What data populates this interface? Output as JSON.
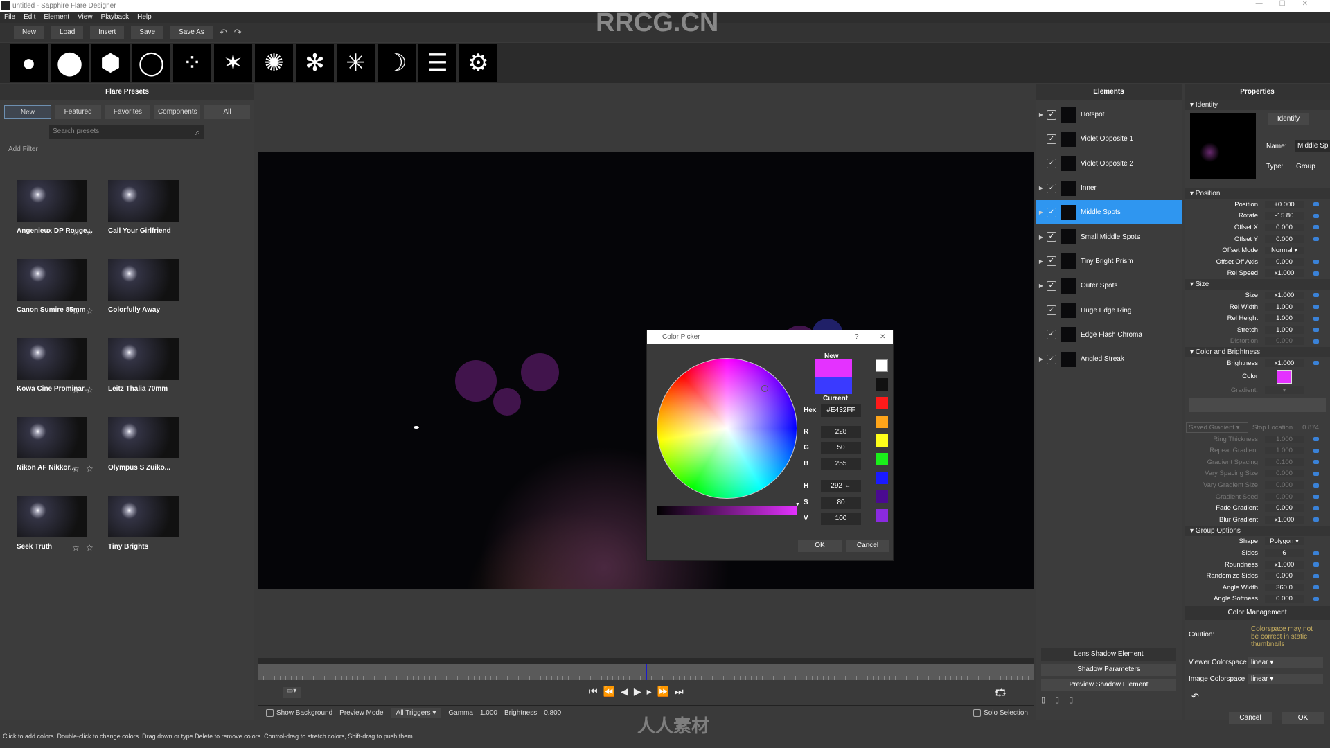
{
  "window": {
    "title": "untitled - Sapphire Flare Designer",
    "watermark": "RRCG.CN",
    "bottom_watermark": "人人素材"
  },
  "menu": [
    "File",
    "Edit",
    "Element",
    "View",
    "Playback",
    "Help"
  ],
  "toolbar": {
    "buttons": [
      "New",
      "Load",
      "Insert",
      "Save",
      "Save As"
    ],
    "icons": [
      "undo-icon",
      "redo-icon"
    ]
  },
  "element_strip": [
    "glow",
    "disc",
    "polygon",
    "ring",
    "spots",
    "star-streak",
    "rays",
    "starburst",
    "sparkle",
    "arc",
    "streaks",
    "settings"
  ],
  "presets_panel": {
    "title": "Flare Presets",
    "tabs": [
      "New",
      "Featured",
      "Favorites",
      "Components",
      "All"
    ],
    "active_tab": "New",
    "search_placeholder": "Search presets",
    "add_filter": "Add Filter",
    "presets": [
      "Angenieux DP Rouge...",
      "Call Your Girlfriend",
      "Canon Sumire 85mm",
      "Colorfully Away",
      "Kowa Cine Prominar...",
      "Leitz Thalia 70mm",
      "Nikon AF Nikkor...",
      "Olympus S Zuiko...",
      "Seek Truth",
      "Tiny Brights"
    ]
  },
  "viewer": {
    "show_background": "Show Background",
    "preview_mode": "Preview Mode",
    "triggers": "All Triggers",
    "gamma_label": "Gamma",
    "gamma": "1.000",
    "brightness_label": "Brightness",
    "brightness": "0.800",
    "solo_selection": "Solo Selection"
  },
  "status": "Click to add colors. Double-click to change colors. Drag down or type Delete to remove colors. Control-drag to stretch colors, Shift-drag to push them.",
  "elements_panel": {
    "title": "Elements",
    "selected": "Middle Spots",
    "items": [
      {
        "name": "Hotspot",
        "expand": true
      },
      {
        "name": "Violet Opposite 1",
        "expand": false
      },
      {
        "name": "Violet Opposite 2",
        "expand": false
      },
      {
        "name": "Inner",
        "expand": true
      },
      {
        "name": "Middle Spots",
        "expand": true
      },
      {
        "name": "Small Middle Spots",
        "expand": true
      },
      {
        "name": "Tiny Bright Prism",
        "expand": true
      },
      {
        "name": "Outer Spots",
        "expand": true
      },
      {
        "name": "Huge Edge Ring",
        "expand": false
      },
      {
        "name": "Edge Flash Chroma",
        "expand": false
      },
      {
        "name": "Angled Streak",
        "expand": true
      }
    ],
    "lens_shadow": "Lens Shadow Element",
    "shadow_params": "Shadow Parameters",
    "preview_shadow": "Preview Shadow Element"
  },
  "properties": {
    "title": "Properties",
    "identity": "Identity",
    "identify": "Identify",
    "name_label": "Name:",
    "name": "Middle Sp",
    "type_label": "Type:",
    "type": "Group",
    "position_section": "Position",
    "position": [
      [
        "Position",
        "+0.000"
      ],
      [
        "Rotate",
        "-15.80"
      ],
      [
        "Offset X",
        "0.000"
      ],
      [
        "Offset Y",
        "0.000"
      ],
      [
        "Offset Mode",
        "Normal"
      ],
      [
        "Offset Off Axis",
        "0.000"
      ],
      [
        "Rel Speed",
        "x1.000"
      ]
    ],
    "size_section": "Size",
    "size": [
      [
        "Size",
        "x1.000"
      ],
      [
        "Rel Width",
        "1.000"
      ],
      [
        "Rel Height",
        "1.000"
      ],
      [
        "Stretch",
        "1.000"
      ],
      [
        "Distortion",
        "0.000"
      ]
    ],
    "color_section": "Color and Brightness",
    "brightness": [
      "Brightness",
      "x1.000"
    ],
    "color_label": "Color",
    "color": "#E432FF",
    "gradient_label": "Gradient:",
    "saved_gradient": "Saved Gradient",
    "stop_location_label": "Stop Location",
    "stop_location": "0.874",
    "gradient": [
      [
        "Ring Thickness",
        "1.000",
        true
      ],
      [
        "Repeat Gradient",
        "1.000",
        true
      ],
      [
        "Gradient Spacing",
        "0.100",
        true
      ],
      [
        "Vary Spacing Size",
        "0.000",
        true
      ],
      [
        "Vary Gradient Size",
        "0.000",
        true
      ],
      [
        "Gradient Seed",
        "0.000",
        true
      ],
      [
        "Fade Gradient",
        "0.000",
        false
      ],
      [
        "Blur Gradient",
        "x1.000",
        false
      ]
    ],
    "group_section": "Group Options",
    "group": [
      [
        "Shape",
        "Polygon"
      ],
      [
        "Sides",
        "6"
      ],
      [
        "Roundness",
        "x1.000"
      ],
      [
        "Randomize Sides",
        "0.000"
      ],
      [
        "Angle Width",
        "360.0"
      ],
      [
        "Angle Softness",
        "0.000"
      ]
    ],
    "color_management": "Color Management",
    "caution_label": "Caution:",
    "caution": "Colorspace may not be correct in static thumbnails",
    "viewer_cs_label": "Viewer Colorspace",
    "viewer_cs": "linear",
    "image_cs_label": "Image Colorspace",
    "image_cs": "linear",
    "cancel": "Cancel",
    "ok": "OK"
  },
  "color_picker": {
    "title": "Color Picker",
    "help": "?",
    "new_label": "New",
    "current_label": "Current",
    "new_color": "#E432FF",
    "current_color": "#3A3AFF",
    "hex_label": "Hex",
    "hex": "#E432FF",
    "r": "228",
    "g": "50",
    "b": "255",
    "h": "292",
    "s": "80",
    "v": "100",
    "ok": "OK",
    "cancel": "Cancel",
    "swatches": [
      "#FFFFFF",
      "#111111",
      "#FF1A1A",
      "#FFA51A",
      "#FFFF1A",
      "#1AF01A",
      "#1A1AFF",
      "#4A0A90",
      "#8A2AE0"
    ]
  }
}
